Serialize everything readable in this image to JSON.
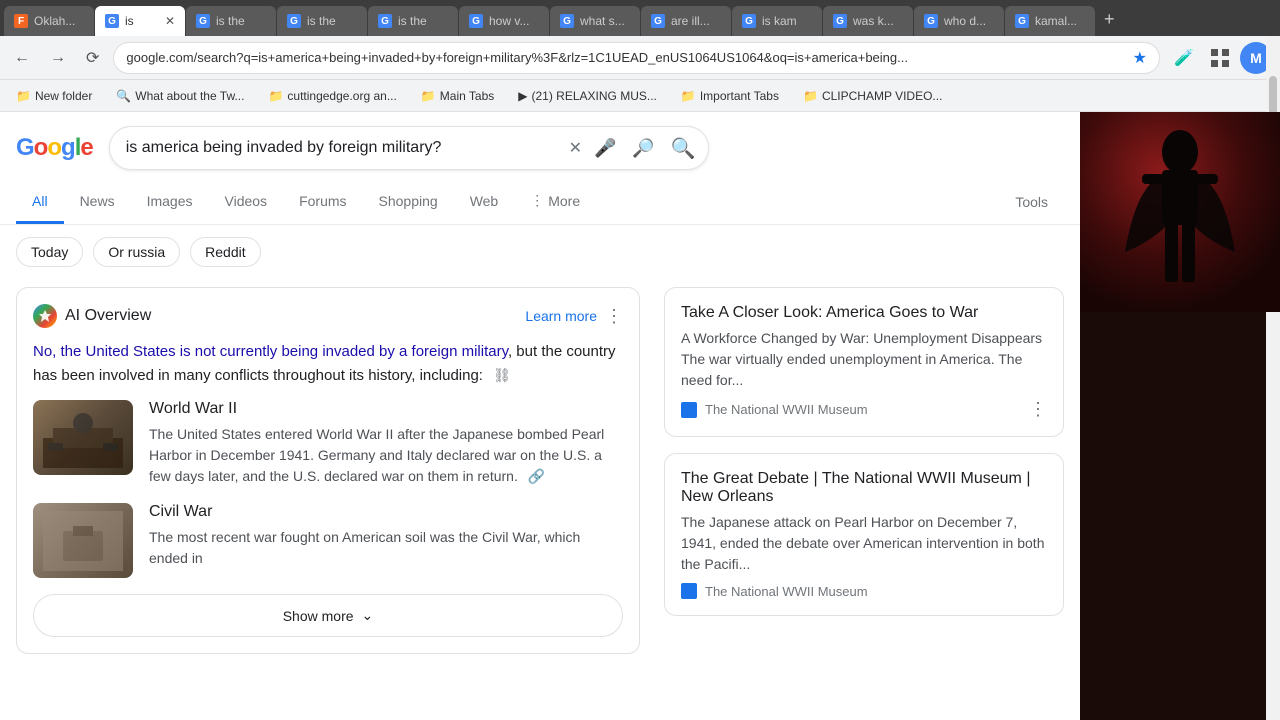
{
  "browser": {
    "tabs": [
      {
        "id": "oklah",
        "favicon_color": "#f26522",
        "favicon_letter": "F",
        "label": "Oklah...",
        "active": false
      },
      {
        "id": "is1",
        "favicon_color": "#4285f4",
        "favicon_letter": "G",
        "label": "is",
        "active": true
      },
      {
        "id": "is2",
        "favicon_color": "#4285f4",
        "favicon_letter": "G",
        "label": "is the",
        "active": false
      },
      {
        "id": "is3",
        "favicon_color": "#4285f4",
        "favicon_letter": "G",
        "label": "is the",
        "active": false
      },
      {
        "id": "is4",
        "favicon_color": "#4285f4",
        "favicon_letter": "G",
        "label": "is the",
        "active": false
      },
      {
        "id": "how",
        "favicon_color": "#4285f4",
        "favicon_letter": "G",
        "label": "how v...",
        "active": false
      },
      {
        "id": "what",
        "favicon_color": "#4285f4",
        "favicon_letter": "G",
        "label": "what s...",
        "active": false
      },
      {
        "id": "are",
        "favicon_color": "#4285f4",
        "favicon_letter": "G",
        "label": "are ill...",
        "active": false
      },
      {
        "id": "is5",
        "favicon_color": "#4285f4",
        "favicon_letter": "G",
        "label": "is kam",
        "active": false
      },
      {
        "id": "was",
        "favicon_color": "#4285f4",
        "favicon_letter": "G",
        "label": "was k...",
        "active": false
      },
      {
        "id": "who",
        "favicon_color": "#4285f4",
        "favicon_letter": "G",
        "label": "who d...",
        "active": false
      },
      {
        "id": "kamal",
        "favicon_color": "#4285f4",
        "favicon_letter": "G",
        "label": "kamal...",
        "active": false
      }
    ],
    "url": "google.com/search?q=is+america+being+invaded+by+foreign+military%3F&rlz=1C1UEAD_enUS1064US1064&oq=is+america+being...",
    "bookmarks": [
      {
        "icon": "📁",
        "label": "New folder"
      },
      {
        "icon": "🔍",
        "label": "What about the Tw..."
      },
      {
        "icon": "📁",
        "label": "cuttingedge.org an..."
      },
      {
        "icon": "📁",
        "label": "Main Tabs"
      },
      {
        "icon": "▶",
        "label": "(21) RELAXING MUS..."
      },
      {
        "icon": "📁",
        "label": "Important Tabs"
      },
      {
        "icon": "📁",
        "label": "CLIPCHAMP VIDEO..."
      }
    ]
  },
  "search": {
    "query": "is america being invaded by foreign military?",
    "placeholder": "Search"
  },
  "tabs": {
    "items": [
      "All",
      "News",
      "Images",
      "Videos",
      "Forums",
      "Shopping",
      "Web",
      "More"
    ],
    "active": "All",
    "tools": "Tools"
  },
  "filters": {
    "chips": [
      "Today",
      "Or russia",
      "Reddit"
    ]
  },
  "ai_overview": {
    "title": "AI Overview",
    "learn_more": "Learn more",
    "answer_highlight": "No, the United States is not currently being invaded by a foreign military",
    "answer_continuation": ", but the country has been involved in many conflicts throughout its history, including:",
    "items": [
      {
        "title": "World War II",
        "text": "The United States entered World War II after the Japanese bombed Pearl Harbor in December 1941. Germany and Italy declared war on the U.S. a few days later, and the U.S. declared war on them in return.",
        "has_link": true
      },
      {
        "title": "Civil War",
        "text": "The most recent war fought on American soil was the Civil War, which ended in",
        "has_link": false
      }
    ],
    "show_more": "Show more"
  },
  "right_cards": [
    {
      "title": "Take A Closer Look: America Goes to War",
      "text": "A Workforce Changed by War: Unemployment Disappears The war virtually ended unemployment in America. The need for...",
      "source": "The National WWII Museum"
    },
    {
      "title": "The Great Debate | The National WWII Museum | New Orleans",
      "text": "The Japanese attack on Pearl Harbor on December 7, 1941, ended the debate over American intervention in both the Pacifi...",
      "source": "The National WWII Museum"
    }
  ],
  "user": {
    "avatar_letter": "M",
    "avatar_color": "#4285f4"
  }
}
